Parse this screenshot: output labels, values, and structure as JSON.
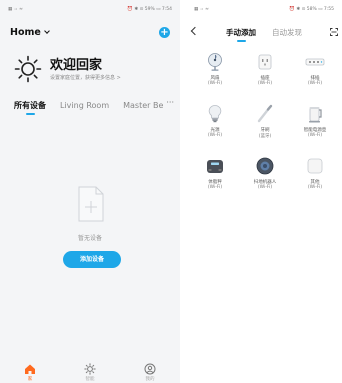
{
  "left": {
    "status": {
      "left": "▦ ᵢₗ ≈",
      "right": "⏰ ✱ ⊙ 59% ▭ 7:54"
    },
    "home_title": "Home",
    "welcome": {
      "title": "欢迎回家",
      "subtitle": "设置家庭位置，获得更多信息 >"
    },
    "tabs": [
      "所有设备",
      "Living Room",
      "Master Be"
    ],
    "tab_more": "···",
    "empty_text": "暂无设备",
    "add_device_button": "添加设备",
    "bottom_nav": [
      {
        "icon": "home-icon",
        "label": "家",
        "active": true
      },
      {
        "icon": "sun-icon",
        "label": "智能",
        "active": false
      },
      {
        "icon": "profile-icon",
        "label": "我的",
        "active": false
      }
    ]
  },
  "right": {
    "status": {
      "left": "▦ ᵢₗ ≈",
      "right": "⏰ ✱ ⊙ 58% ▭ 7:55"
    },
    "tabs": {
      "manual": "手动添加",
      "auto": "自动发现"
    },
    "devices": [
      {
        "name": "风扇",
        "sub": "(Wi-Fi)",
        "icon": "fan-icon"
      },
      {
        "name": "插座",
        "sub": "(Wi-Fi)",
        "icon": "socket-icon"
      },
      {
        "name": "排插",
        "sub": "(Wi-Fi)",
        "icon": "power-strip-icon"
      },
      {
        "name": "光源",
        "sub": "(Wi-Fi)",
        "icon": "bulb-icon"
      },
      {
        "name": "牙刷",
        "sub": "(蓝牙)",
        "icon": "toothbrush-icon"
      },
      {
        "name": "智能电源壶",
        "sub": "(Wi-Fi)",
        "icon": "kettle-icon"
      },
      {
        "name": "体脂秤",
        "sub": "(Wi-Fi)",
        "icon": "scale-icon"
      },
      {
        "name": "扫地机器人",
        "sub": "(Wi-Fi)",
        "icon": "robot-vacuum-icon"
      },
      {
        "name": "其他",
        "sub": "(Wi-Fi)",
        "icon": "other-device-icon"
      }
    ]
  },
  "colors": {
    "accent": "#1ea7e8",
    "active_nav": "#ff6a1f"
  }
}
